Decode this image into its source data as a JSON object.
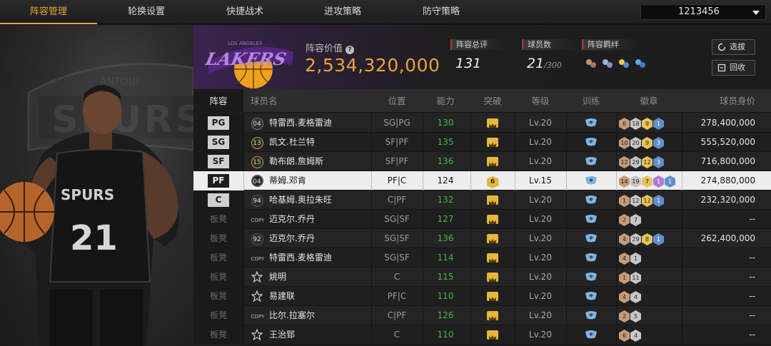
{
  "nav": {
    "tabs": [
      "阵容管理",
      "轮换设置",
      "快捷战术",
      "进攻策略",
      "防守策略"
    ],
    "active_index": 0,
    "account_id": "1213456"
  },
  "header": {
    "value_label": "阵容价值",
    "value": "2,534,320,000",
    "stats": [
      {
        "label": "阵容总评",
        "value": "131",
        "sub": ""
      },
      {
        "label": "球员数",
        "value": "21",
        "sub": "/300"
      },
      {
        "label": "阵容羁绊",
        "value": "",
        "sub": ""
      }
    ],
    "buttons": {
      "scout": "选拔",
      "recycle": "回收"
    },
    "colors": {
      "accent": "#e8a53a",
      "team_purple": "#552583",
      "team_gold": "#fdb927",
      "ovr_green": "#43b84a"
    }
  },
  "table": {
    "headers": [
      "阵容",
      "球员名",
      "位置",
      "能力",
      "突破",
      "等级",
      "训练",
      "徽章",
      "球员身价"
    ],
    "rows": [
      {
        "slot": "PG",
        "bench": false,
        "num": "04",
        "num_style": "dark",
        "name": "特雷西.麦格雷迪",
        "pos": "SG|PG",
        "ovr": "130",
        "brk": "",
        "lvl": "Lv.20",
        "badges": [
          {
            "t": "b-bronze",
            "v": "6"
          },
          {
            "t": "b-silver",
            "v": "18"
          },
          {
            "t": "b-gold",
            "v": "9"
          },
          {
            "t": "b-blue",
            "v": "1"
          }
        ],
        "value": "278,400,000"
      },
      {
        "slot": "SG",
        "bench": false,
        "num": "13",
        "num_style": "gold",
        "name": "凯文.杜兰特",
        "pos": "SF|PF",
        "ovr": "135",
        "brk": "",
        "lvl": "Lv.20",
        "badges": [
          {
            "t": "b-bronze",
            "v": "10"
          },
          {
            "t": "b-silver",
            "v": "20"
          },
          {
            "t": "b-gold",
            "v": "9"
          },
          {
            "t": "b-blue",
            "v": "3"
          }
        ],
        "value": "555,520,000"
      },
      {
        "slot": "SF",
        "bench": false,
        "num": "15",
        "num_style": "gold",
        "name": "勒布朗.詹姆斯",
        "pos": "SF|PF",
        "ovr": "136",
        "brk": "",
        "lvl": "Lv.20",
        "badges": [
          {
            "t": "b-bronze",
            "v": "12"
          },
          {
            "t": "b-silver",
            "v": "29"
          },
          {
            "t": "b-gold",
            "v": "12"
          },
          {
            "t": "b-blue",
            "v": "3"
          }
        ],
        "value": "716,800,000"
      },
      {
        "slot": "PF",
        "bench": false,
        "num": "04",
        "num_style": "sel",
        "name": "蒂姆.邓肯",
        "pos": "PF|C",
        "ovr": "124",
        "brk": "6",
        "lvl": "Lv.15",
        "badges": [
          {
            "t": "b-bronze",
            "v": "14"
          },
          {
            "t": "b-silver",
            "v": "19"
          },
          {
            "t": "b-gold",
            "v": "7"
          },
          {
            "t": "b-purple",
            "v": "1"
          },
          {
            "t": "b-blue",
            "v": "1"
          }
        ],
        "value": "274,880,000",
        "selected": true
      },
      {
        "slot": "C",
        "bench": false,
        "num": "94",
        "num_style": "plain",
        "name": "哈基姆.奥拉朱旺",
        "pos": "C|PF",
        "ovr": "132",
        "brk": "",
        "lvl": "Lv.20",
        "badges": [
          {
            "t": "b-bronze",
            "v": "1"
          },
          {
            "t": "b-silver",
            "v": "12"
          },
          {
            "t": "b-gold",
            "v": "12"
          },
          {
            "t": "b-blue",
            "v": "1"
          }
        ],
        "value": "232,320,000"
      },
      {
        "slot": "板凳",
        "bench": true,
        "num": "COPY",
        "num_style": "copy",
        "name": "迈克尔.乔丹",
        "pos": "SG|SF",
        "ovr": "127",
        "brk": "",
        "lvl": "Lv.20",
        "badges": [
          {
            "t": "b-bronze",
            "v": "2"
          },
          {
            "t": "b-silver",
            "v": "7"
          }
        ],
        "value": "--"
      },
      {
        "slot": "板凳",
        "bench": true,
        "num": "92",
        "num_style": "plain",
        "name": "迈克尔.乔丹",
        "pos": "SG|SF",
        "ovr": "136",
        "brk": "",
        "lvl": "Lv.20",
        "badges": [
          {
            "t": "b-bronze",
            "v": "4"
          },
          {
            "t": "b-silver",
            "v": "29"
          },
          {
            "t": "b-gold",
            "v": "8"
          },
          {
            "t": "b-blue",
            "v": "1"
          }
        ],
        "value": "262,400,000"
      },
      {
        "slot": "板凳",
        "bench": true,
        "num": "COPY",
        "num_style": "copy",
        "name": "特雷西.麦格雷迪",
        "pos": "SG|SF",
        "ovr": "114",
        "brk": "",
        "lvl": "Lv.20",
        "badges": [
          {
            "t": "b-bronze",
            "v": "4"
          },
          {
            "t": "b-silver",
            "v": "1"
          }
        ],
        "value": "--"
      },
      {
        "slot": "板凳",
        "bench": true,
        "num": "",
        "num_style": "star",
        "name": "姚明",
        "pos": "C",
        "ovr": "115",
        "brk": "",
        "lvl": "Lv.20",
        "badges": [
          {
            "t": "b-bronze",
            "v": "1"
          },
          {
            "t": "b-silver",
            "v": "11"
          }
        ],
        "value": "--"
      },
      {
        "slot": "板凳",
        "bench": true,
        "num": "",
        "num_style": "star",
        "name": "易建联",
        "pos": "PF|C",
        "ovr": "110",
        "brk": "",
        "lvl": "Lv.20",
        "badges": [
          {
            "t": "b-bronze",
            "v": "4"
          },
          {
            "t": "b-silver",
            "v": "4"
          }
        ],
        "value": "--"
      },
      {
        "slot": "板凳",
        "bench": true,
        "num": "COPY",
        "num_style": "copy",
        "name": "比尔.拉塞尔",
        "pos": "C|PF",
        "ovr": "126",
        "brk": "",
        "lvl": "Lv.20",
        "badges": [
          {
            "t": "b-bronze",
            "v": "2"
          },
          {
            "t": "b-silver",
            "v": "5"
          }
        ],
        "value": "--"
      },
      {
        "slot": "板凳",
        "bench": true,
        "num": "",
        "num_style": "star",
        "name": "王治郅",
        "pos": "C",
        "ovr": "110",
        "brk": "",
        "lvl": "Lv.20",
        "badges": [
          {
            "t": "b-bronze",
            "v": "6"
          },
          {
            "t": "b-silver",
            "v": "4"
          }
        ],
        "value": "--"
      }
    ]
  }
}
